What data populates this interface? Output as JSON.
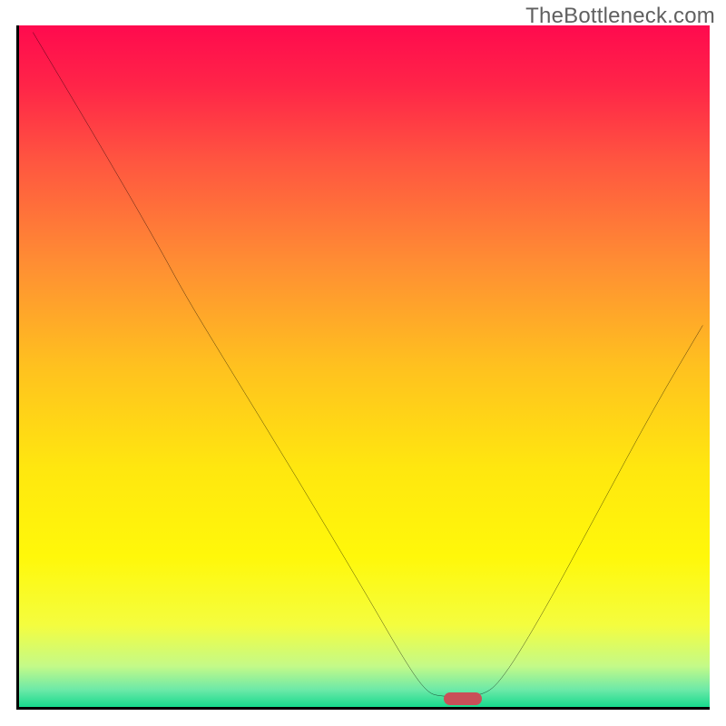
{
  "watermark": "TheBottleneck.com",
  "chart_data": {
    "type": "line",
    "title": "",
    "xlabel": "",
    "ylabel": "",
    "xlim": [
      0,
      100
    ],
    "ylim": [
      0,
      100
    ],
    "grid": false,
    "background": {
      "type": "vertical-gradient",
      "stops": [
        {
          "pos": 0.0,
          "color": "#ff0a4e"
        },
        {
          "pos": 0.09,
          "color": "#ff2548"
        },
        {
          "pos": 0.2,
          "color": "#ff5640"
        },
        {
          "pos": 0.35,
          "color": "#ff8e33"
        },
        {
          "pos": 0.5,
          "color": "#ffc11f"
        },
        {
          "pos": 0.65,
          "color": "#ffe70f"
        },
        {
          "pos": 0.78,
          "color": "#fff80a"
        },
        {
          "pos": 0.88,
          "color": "#f4fd3f"
        },
        {
          "pos": 0.94,
          "color": "#c4fa88"
        },
        {
          "pos": 0.975,
          "color": "#6ce9a8"
        },
        {
          "pos": 1.0,
          "color": "#17da8d"
        }
      ]
    },
    "series": [
      {
        "name": "bottleneck-curve",
        "color": "#000000",
        "points": [
          {
            "x": 2.0,
            "y": 99.0
          },
          {
            "x": 12.0,
            "y": 82.0
          },
          {
            "x": 20.0,
            "y": 68.0
          },
          {
            "x": 24.0,
            "y": 60.5
          },
          {
            "x": 30.0,
            "y": 50.5
          },
          {
            "x": 40.0,
            "y": 34.0
          },
          {
            "x": 50.0,
            "y": 17.0
          },
          {
            "x": 56.0,
            "y": 6.5
          },
          {
            "x": 59.0,
            "y": 2.2
          },
          {
            "x": 61.0,
            "y": 1.5
          },
          {
            "x": 67.0,
            "y": 1.5
          },
          {
            "x": 70.0,
            "y": 4.0
          },
          {
            "x": 76.0,
            "y": 14.0
          },
          {
            "x": 84.0,
            "y": 29.0
          },
          {
            "x": 92.0,
            "y": 44.0
          },
          {
            "x": 99.0,
            "y": 56.0
          }
        ]
      }
    ],
    "marker": {
      "name": "optimal-zone",
      "color": "#c94f58",
      "x_start": 61.5,
      "x_end": 67.0,
      "y": 1.2
    }
  }
}
